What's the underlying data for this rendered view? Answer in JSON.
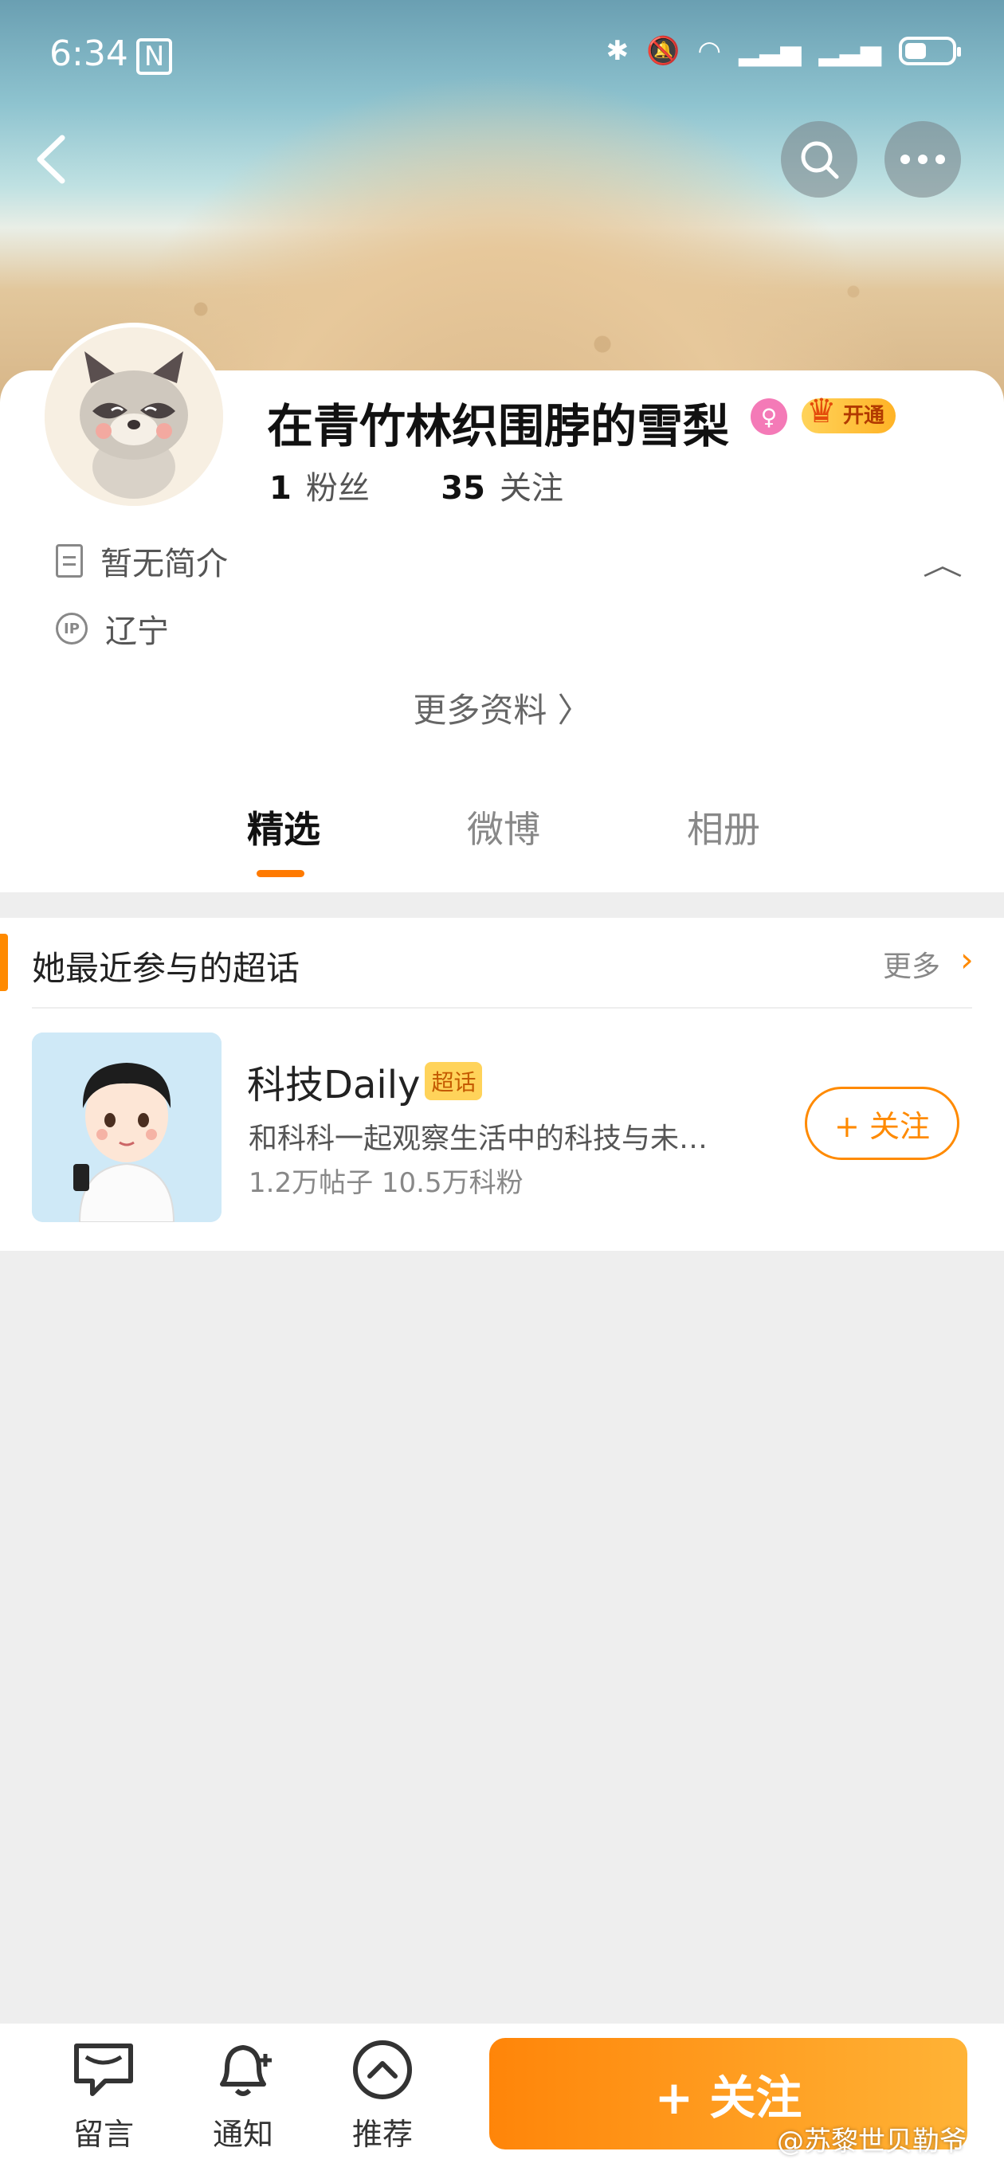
{
  "status_bar": {
    "time": "6:34",
    "time_badge": "N"
  },
  "profile": {
    "username": "在青竹林织围脖的雪梨",
    "gender_symbol": "♀",
    "vip_label": "开通",
    "fans_count": "1",
    "fans_label": "粉丝",
    "following_count": "35",
    "following_label": "关注",
    "bio": "暂无简介",
    "ip_location": "辽宁",
    "more_info": "更多资料 〉"
  },
  "tabs": [
    {
      "label": "精选",
      "active": true
    },
    {
      "label": "微博",
      "active": false
    },
    {
      "label": "相册",
      "active": false
    }
  ],
  "super_topics": {
    "title": "她最近参与的超话",
    "more_label": "更多",
    "items": [
      {
        "name": "科技Daily",
        "tag": "超话",
        "desc": "和科科一起观察生活中的科技与未…",
        "stats": "1.2万帖子 10.5万科粉",
        "follow_label": "+ 关注"
      }
    ]
  },
  "bottom_bar": {
    "comment_label": "留言",
    "notify_label": "通知",
    "recommend_label": "推荐",
    "follow_label": "+ 关注"
  },
  "watermark": "@苏黎世贝勒爷",
  "colors": {
    "accent": "#ff8a00",
    "background": "#eeeeee",
    "vip": "#ffb326",
    "female": "#f47ab7"
  }
}
